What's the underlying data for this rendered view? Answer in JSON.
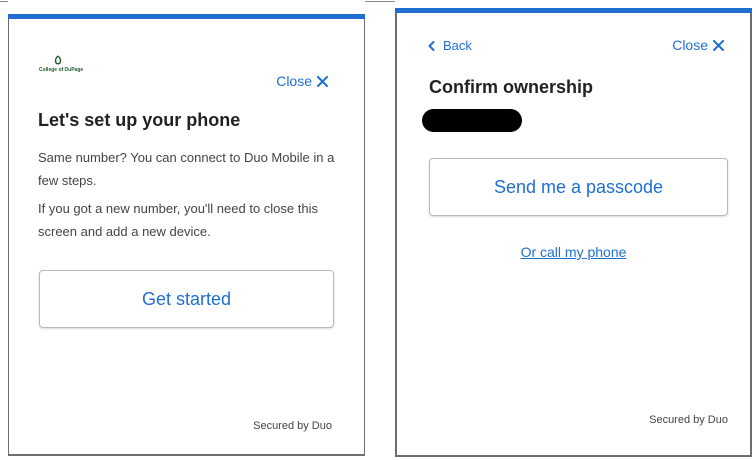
{
  "brand": {
    "accent": "#1f6fd1",
    "text": "#222222",
    "muted": "#444444",
    "logo_green": "#1d5a2e"
  },
  "setup_panel": {
    "logo_text": "College of DuPage",
    "close_label": "Close",
    "title": "Let's set up your phone",
    "paragraph_1": "Same number? You can connect to Duo Mobile in a few steps.",
    "paragraph_2": "If you got a new number, you'll need to close this screen and add a new device.",
    "primary_button": "Get started",
    "footer": "Secured by Duo"
  },
  "confirm_panel": {
    "back_label": "Back",
    "close_label": "Close",
    "title": "Confirm ownership",
    "primary_button": "Send me a passcode",
    "secondary_link": "Or call my phone",
    "footer": "Secured by Duo"
  },
  "icons": {
    "close": "close-x-icon",
    "back": "chevron-left-icon",
    "logo": "college-logo-icon"
  }
}
